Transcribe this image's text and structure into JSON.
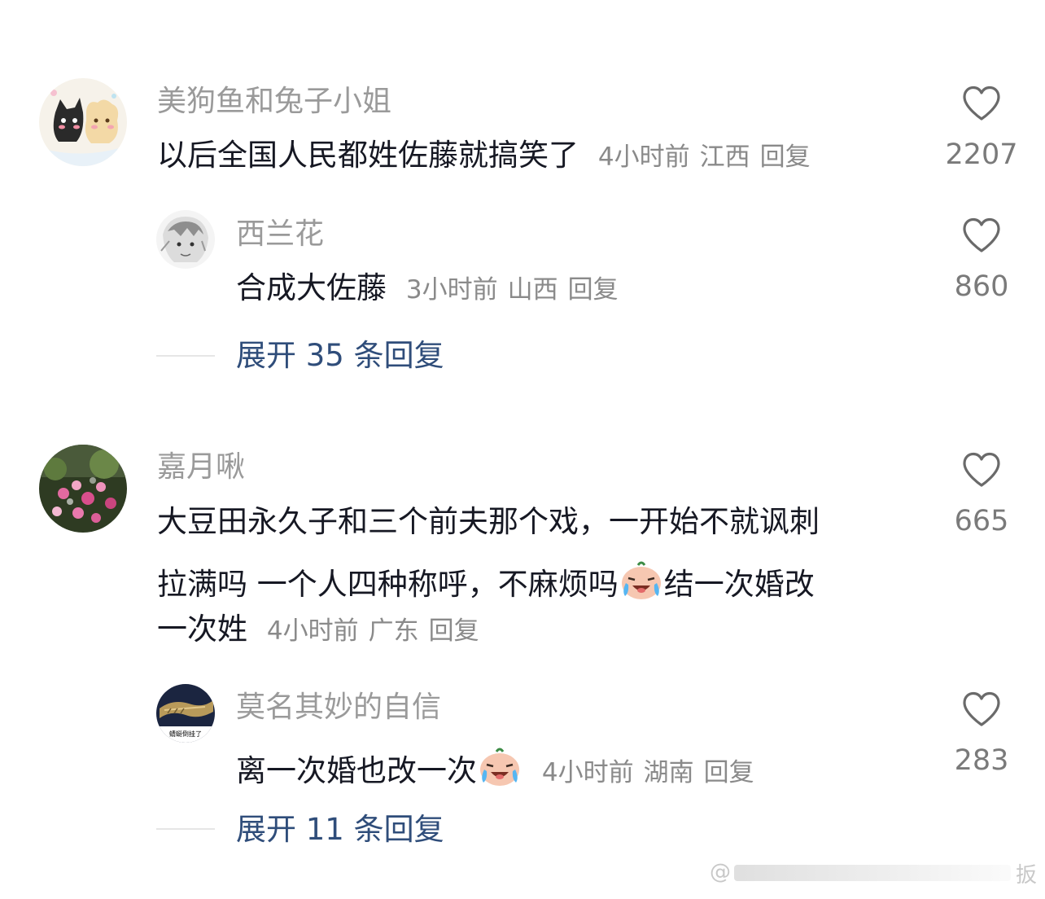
{
  "comments": [
    {
      "author": "美狗鱼和兔子小姐",
      "text": "以后全国人民都姓佐藤就搞笑了",
      "time": "4小时前",
      "location": "江西",
      "reply_label": "回复",
      "likes": "2207",
      "reply": {
        "author": "西兰花",
        "text": "合成大佐藤",
        "time": "3小时前",
        "location": "山西",
        "reply_label": "回复",
        "likes": "860"
      },
      "expand_label": "展开 35 条回复"
    },
    {
      "author": "嘉月啾",
      "text_line1": "大豆田永久子和三个前夫那个戏，一开始不就讽刺",
      "text_line2a": "拉满吗 一个人四种称呼，不麻烦吗",
      "text_line2b": "结一次婚改",
      "text_line3": "一次姓",
      "emoji": "crying-laughing-baby-emoji",
      "time": "4小时前",
      "location": "广东",
      "reply_label": "回复",
      "likes": "665",
      "reply": {
        "author": "莫名其妙的自信",
        "avatar_caption": "蜻蜓倒挂了",
        "text": "离一次婚也改一次",
        "emoji": "crying-laughing-baby-emoji",
        "time": "4小时前",
        "location": "湖南",
        "reply_label": "回复",
        "likes": "283"
      },
      "expand_label": "展开 11 条回复"
    }
  ],
  "watermark": "@",
  "watermark_end": "扳",
  "colors": {
    "link": "#2f4d7a",
    "meta": "#8a8a8a",
    "name": "#9a9a9a",
    "text": "#161823"
  }
}
